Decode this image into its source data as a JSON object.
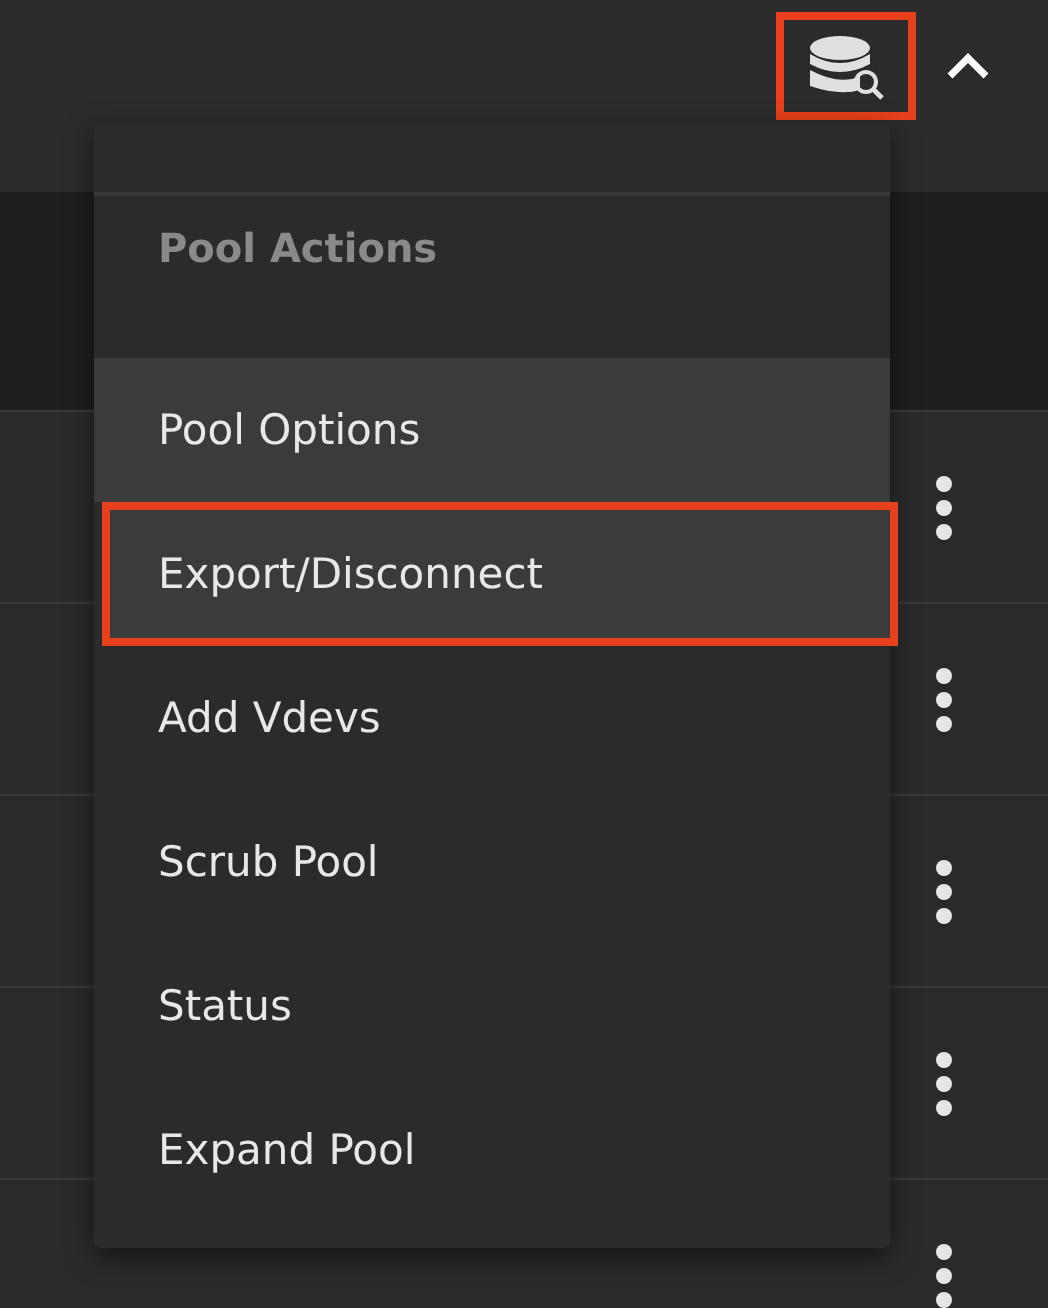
{
  "toolbar": {
    "pool_icon": {
      "annotated": true
    },
    "collapse": {
      "expanded": true
    }
  },
  "rows": [
    {
      "kind": "actions"
    },
    {
      "kind": "actions"
    },
    {
      "kind": "actions"
    },
    {
      "kind": "actions"
    },
    {
      "kind": "actions"
    }
  ],
  "menu": {
    "heading": "Pool Actions",
    "items": [
      {
        "label": "Pool Options",
        "highlighted": true,
        "annotated": false
      },
      {
        "label": "Export/Disconnect",
        "highlighted": true,
        "annotated": true
      },
      {
        "label": "Add Vdevs",
        "highlighted": false,
        "annotated": false
      },
      {
        "label": "Scrub Pool",
        "highlighted": false,
        "annotated": false
      },
      {
        "label": "Status",
        "highlighted": false,
        "annotated": false
      },
      {
        "label": "Expand Pool",
        "highlighted": false,
        "annotated": false
      }
    ]
  }
}
